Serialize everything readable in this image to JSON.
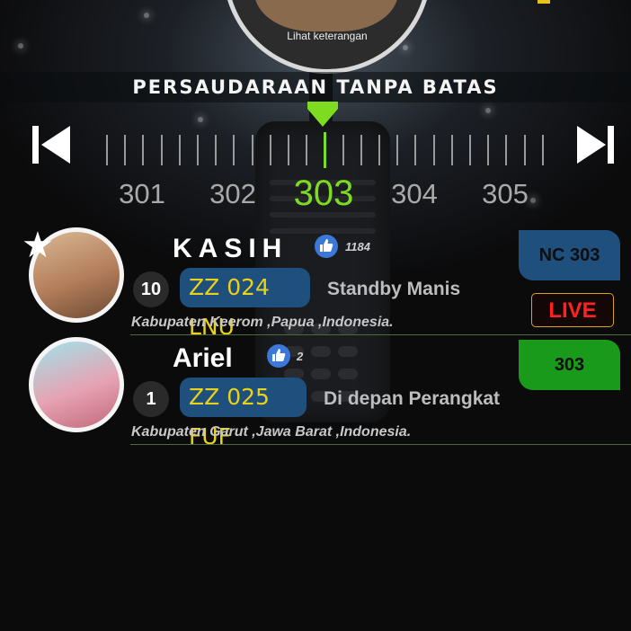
{
  "top_profile": {
    "caption": "Lihat keterangan"
  },
  "banner": {
    "title": "PERSAUDARAAN TANPA BATAS"
  },
  "tuner": {
    "frequencies": [
      "301",
      "302",
      "303",
      "304",
      "305"
    ],
    "active": "303"
  },
  "contacts": [
    {
      "name": "KASIH",
      "likes": "1184",
      "rank": "10",
      "callsign": "ZZ 024 LNU",
      "status": "Standby Manis",
      "location": "Kabupaten Keerom ,Papua ,Indonesia.",
      "channel": "NC 303",
      "channel_color": "#1f4f7c",
      "channel_text_color": "#0e0e0e",
      "live": "LIVE"
    },
    {
      "name": "Ariel",
      "likes": "2",
      "rank": "1",
      "callsign": "ZZ 025 FUF",
      "status": "Di depan Perangkat",
      "location": "Kabupaten Garut ,Jawa Barat ,Indonesia.",
      "channel": "303",
      "channel_color": "#1a9a1a",
      "channel_text_color": "#0e0e0e"
    }
  ],
  "colors": {
    "accent_green": "#7ddc1f",
    "callsign_bg": "#1f4f7c",
    "callsign_text": "#e8d21c",
    "live_red": "#ff2222"
  },
  "icons": [
    "skip-previous-icon",
    "skip-next-icon",
    "thumbs-up-icon",
    "star-icon"
  ]
}
